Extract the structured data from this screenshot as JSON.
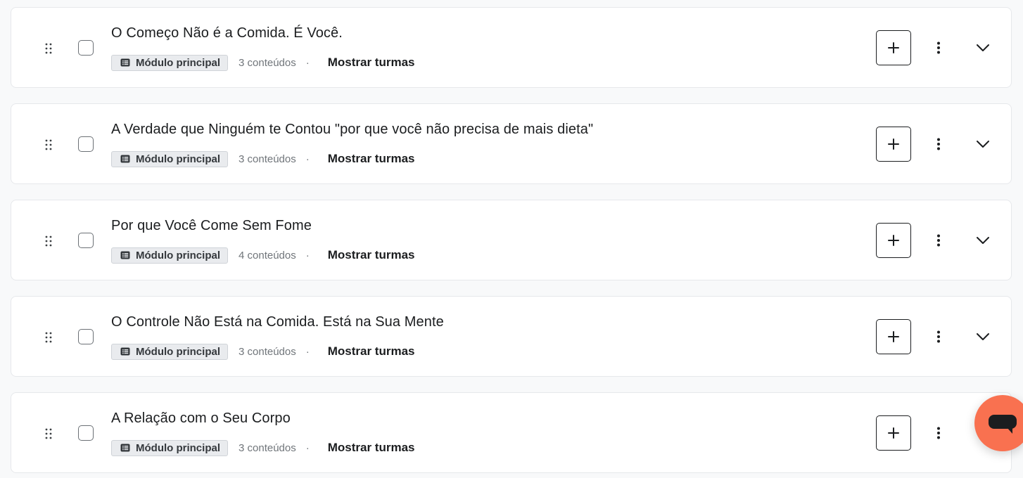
{
  "modules": [
    {
      "title": "O Começo Não é a Comida. É Você.",
      "badge": "Módulo principal",
      "count": "3 conteúdos",
      "separator": "·",
      "action": "Mostrar turmas",
      "expandable": true
    },
    {
      "title": "A Verdade que Ninguém te Contou \"por que você não precisa de mais dieta\"",
      "badge": "Módulo principal",
      "count": "3 conteúdos",
      "separator": "·",
      "action": "Mostrar turmas",
      "expandable": true
    },
    {
      "title": "Por que Você Come Sem Fome",
      "badge": "Módulo principal",
      "count": "4 conteúdos",
      "separator": "·",
      "action": "Mostrar turmas",
      "expandable": true
    },
    {
      "title": "O Controle Não Está na Comida. Está na Sua Mente",
      "badge": "Módulo principal",
      "count": "3 conteúdos",
      "separator": "·",
      "action": "Mostrar turmas",
      "expandable": true
    },
    {
      "title": "A Relação com o Seu Corpo",
      "badge": "Módulo principal",
      "count": "3 conteúdos",
      "separator": "·",
      "action": "Mostrar turmas",
      "expandable": false
    }
  ],
  "icons": {
    "drag": "drag-handle-icon",
    "badge": "list-icon",
    "add": "plus-icon",
    "more": "more-vertical-icon",
    "expand": "chevron-down-icon",
    "chat": "chat-icon"
  },
  "colors": {
    "chat_accent": "#f97150",
    "card_border": "#e6e8eb",
    "badge_bg": "#e9ebee"
  }
}
